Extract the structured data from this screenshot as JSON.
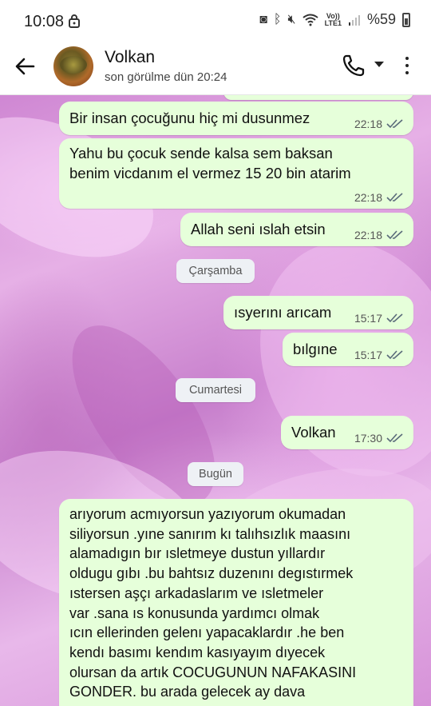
{
  "status_bar": {
    "time": "10:08",
    "lte": "Vo))\nLTE1",
    "battery": "%59"
  },
  "header": {
    "contact_name": "Volkan",
    "last_seen": "son görülme dün 20:24"
  },
  "messages": [
    {
      "text": "Bir insan çocuğunu hiç mi dusunmez",
      "time": "22:18"
    },
    {
      "text": "Yahu bu çocuk sende kalsa sem baksan\nbenim vicdanım el vermez 15 20 bin atarim",
      "time": "22:18"
    },
    {
      "text": "Allah seni ıslah etsin",
      "time": "22:18"
    },
    {
      "text": "ısyerını arıcam",
      "time": "15:17"
    },
    {
      "text": "bılgıne",
      "time": "15:17"
    },
    {
      "text": "Volkan",
      "time": "17:30"
    },
    {
      "text": "arıyorum acmıyorsun yazıyorum okumadan\nsiliyorsun .yıne sanırım kı talıhsızlık maasını\nalamadıgın bır ısletmeye dustun yıllardır\noldugu gıbı .bu bahtsız duzenını degıstırmek\nıstersen aşçı arkadaslarım ve ısletmeler\nvar .sana ıs konusunda yardımcı olmak\nıcın ellerinden gelenı yapacaklardır .he ben\nkendı basımı kendım kasıyayım dıyecek\nolursan da artık COCUGUNUN NAFAKASINI\nGONDER. bu arada gelecek ay dava",
      "time": ""
    }
  ],
  "date_separators": [
    "Çarşamba",
    "Cumartesi",
    "Bugün"
  ],
  "colors": {
    "outgoing_bubble": "#e6ffda",
    "tick_read": "#5a6b7a",
    "pill_bg": "#eef1f5"
  }
}
